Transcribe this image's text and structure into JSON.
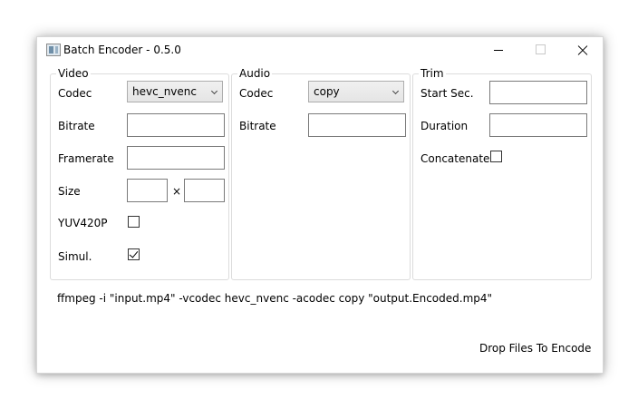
{
  "window": {
    "title": "Batch Encoder - 0.5.0"
  },
  "video": {
    "group_title": "Video",
    "codec_label": "Codec",
    "codec_value": "hevc_nvenc",
    "bitrate_label": "Bitrate",
    "bitrate_value": "",
    "framerate_label": "Framerate",
    "framerate_value": "",
    "size_label": "Size",
    "size_width": "",
    "size_sep": "×",
    "size_height": "",
    "yuv_label": "YUV420P",
    "yuv_checked": false,
    "simul_label": "Simul.",
    "simul_checked": true
  },
  "audio": {
    "group_title": "Audio",
    "codec_label": "Codec",
    "codec_value": "copy",
    "bitrate_label": "Bitrate",
    "bitrate_value": ""
  },
  "trim": {
    "group_title": "Trim",
    "start_label": "Start Sec.",
    "start_value": "",
    "duration_label": "Duration",
    "duration_value": "",
    "concat_label": "Concatenate",
    "concat_checked": false
  },
  "command_preview": "ffmpeg -i \"input.mp4\" -vcodec hevc_nvenc -acodec copy \"output.Encoded.mp4\"",
  "drop_hint": "Drop Files To Encode"
}
